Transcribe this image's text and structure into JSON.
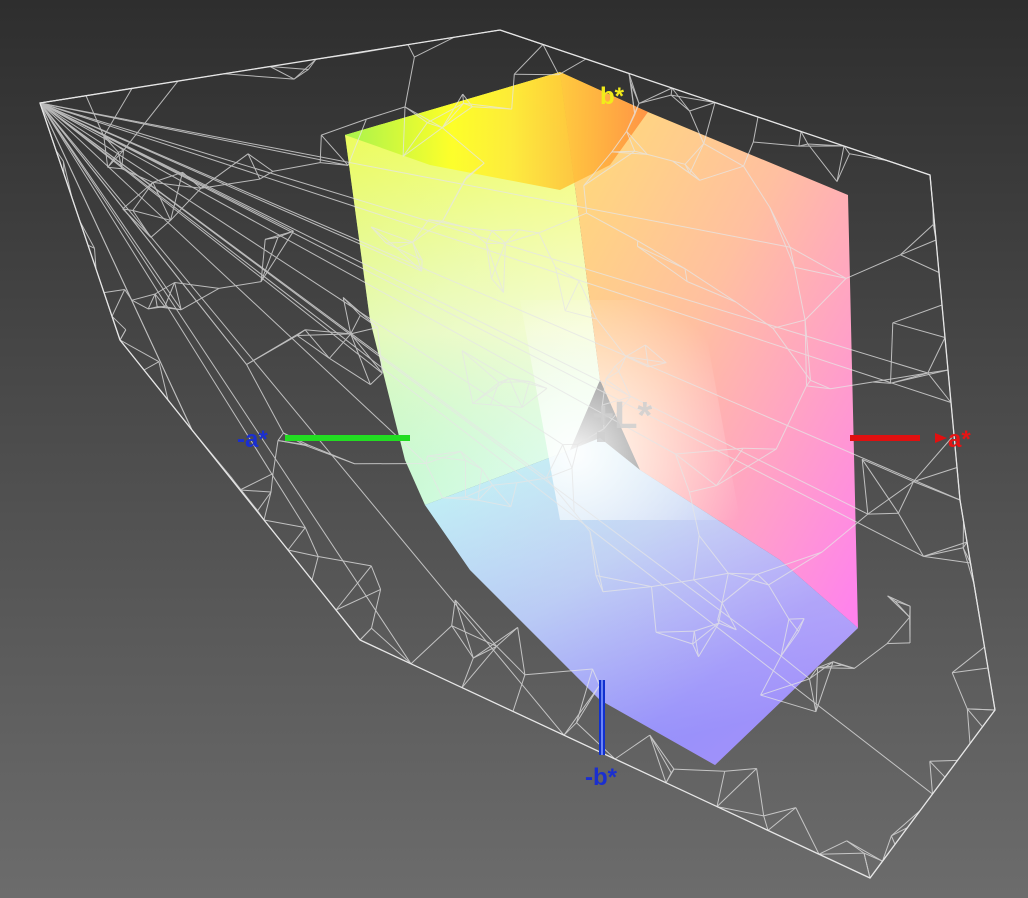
{
  "axes": {
    "b_plus": {
      "label": "b*",
      "color": "#f2ec1a"
    },
    "a_minus": {
      "label": "-a*",
      "color": "#1a2fd0"
    },
    "a_plus": {
      "label": "a*",
      "color": "#e61414"
    },
    "b_minus": {
      "label": "-b*",
      "color": "#1a2fd0"
    },
    "L_plus": {
      "label": "+L*",
      "color": "#d0d0d0"
    }
  },
  "colors": {
    "background_top": "#2e2e2e",
    "background_bottom": "#6c6c6c",
    "wireframe": "#e6e6e6",
    "a_minus_axis_line": "#22dd22",
    "a_plus_axis_line": "#e01010",
    "b_minus_axis_line": "#1030d0"
  }
}
